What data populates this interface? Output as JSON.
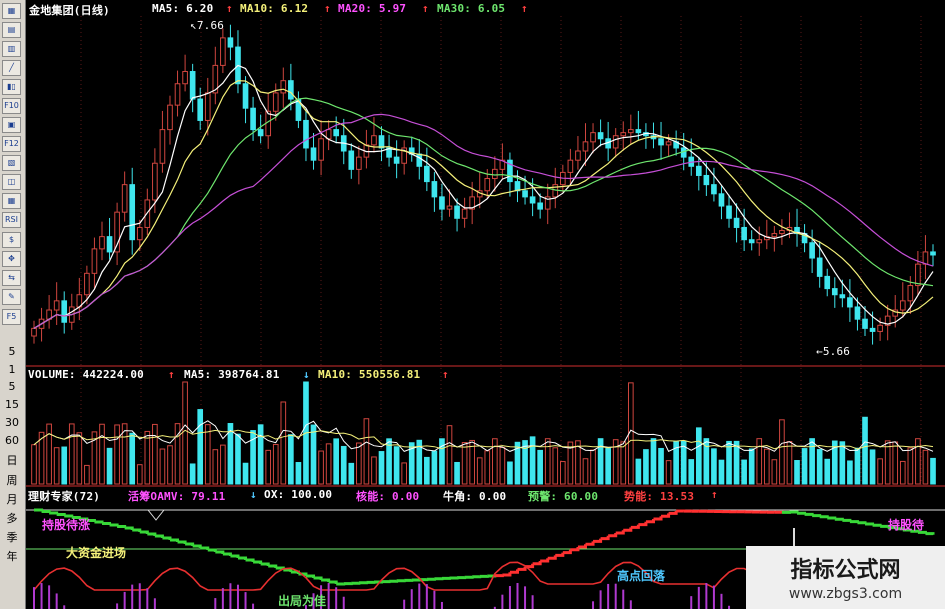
{
  "toolbar": {
    "buttons": [
      "▦",
      "▤",
      "▥",
      "╱",
      "▮▯",
      "F10",
      "▣",
      "F12",
      "▧",
      "◫",
      "▦",
      "RSI",
      "$",
      "✥",
      "⇆",
      "✎",
      "F5"
    ],
    "periods": [
      "5",
      "1",
      "5",
      "15",
      "30",
      "60",
      "日",
      "周",
      "月",
      "多",
      "季",
      "年"
    ]
  },
  "main": {
    "stock_name": "金地集团(日线)",
    "ma5": "MA5: 6.20",
    "ma10": "MA10: 6.12",
    "ma20": "MA20: 5.97",
    "ma30": "MA30: 6.05",
    "high_label": "7.66",
    "low_label": "5.66"
  },
  "volume": {
    "vol": "VOLUME: 442224.00",
    "ma5": "MA5: 398764.81",
    "ma10": "MA10: 550556.81"
  },
  "indicator": {
    "name": "理财专家(72)",
    "oamv": "活筹OAMV: 79.11",
    "ox": "OX: 100.00",
    "kinetic": "核能: 0.00",
    "bull": "牛角: 0.00",
    "warning": "预警: 60.00",
    "momentum": "势能: 13.53"
  },
  "labels": {
    "hold_wait": "持股待涨",
    "big_funds": "大资金进场",
    "high_fall": "高点回落",
    "exit": "出局为佳",
    "hold_wait_right": "持股待"
  },
  "watermark": {
    "title": "指标公式网",
    "url": "www.zbgs3.com"
  },
  "colors": {
    "up": "#d0463f",
    "down": "#3fe6ee",
    "ma5": "#ffffff",
    "ma10": "#f4f07a",
    "ma20": "#6ee66e",
    "ma30": "#c54fd6",
    "bg": "#000000"
  },
  "chart_data": {
    "type": "candlestick",
    "closes": [
      5.72,
      5.78,
      5.84,
      5.9,
      5.76,
      5.86,
      5.94,
      6.08,
      6.24,
      6.32,
      6.22,
      6.48,
      6.66,
      6.3,
      6.38,
      6.56,
      6.8,
      7.02,
      7.18,
      7.32,
      7.4,
      7.22,
      7.08,
      7.26,
      7.44,
      7.62,
      7.56,
      7.32,
      7.16,
      7.02,
      6.98,
      7.14,
      7.26,
      7.34,
      7.22,
      7.08,
      6.9,
      6.82,
      6.96,
      7.02,
      6.98,
      6.88,
      6.76,
      6.84,
      6.92,
      6.98,
      6.9,
      6.84,
      6.8,
      6.9,
      6.86,
      6.78,
      6.68,
      6.58,
      6.5,
      6.52,
      6.44,
      6.5,
      6.58,
      6.62,
      6.7,
      6.76,
      6.82,
      6.68,
      6.62,
      6.58,
      6.54,
      6.5,
      6.58,
      6.66,
      6.74,
      6.82,
      6.88,
      6.94,
      7.0,
      6.96,
      6.9,
      6.98,
      7.0,
      7.02,
      7.0,
      6.98,
      6.96,
      6.92,
      6.94,
      6.9,
      6.84,
      6.78,
      6.72,
      6.66,
      6.6,
      6.52,
      6.44,
      6.38,
      6.3,
      6.28,
      6.3,
      6.32,
      6.34,
      6.36,
      6.38,
      6.34,
      6.28,
      6.18,
      6.06,
      5.98,
      5.94,
      5.92,
      5.86,
      5.78,
      5.72,
      5.7,
      5.74,
      5.8,
      5.84,
      5.9,
      6.0,
      6.14,
      6.22,
      6.2
    ],
    "y_range": [
      5.5,
      7.75
    ]
  }
}
